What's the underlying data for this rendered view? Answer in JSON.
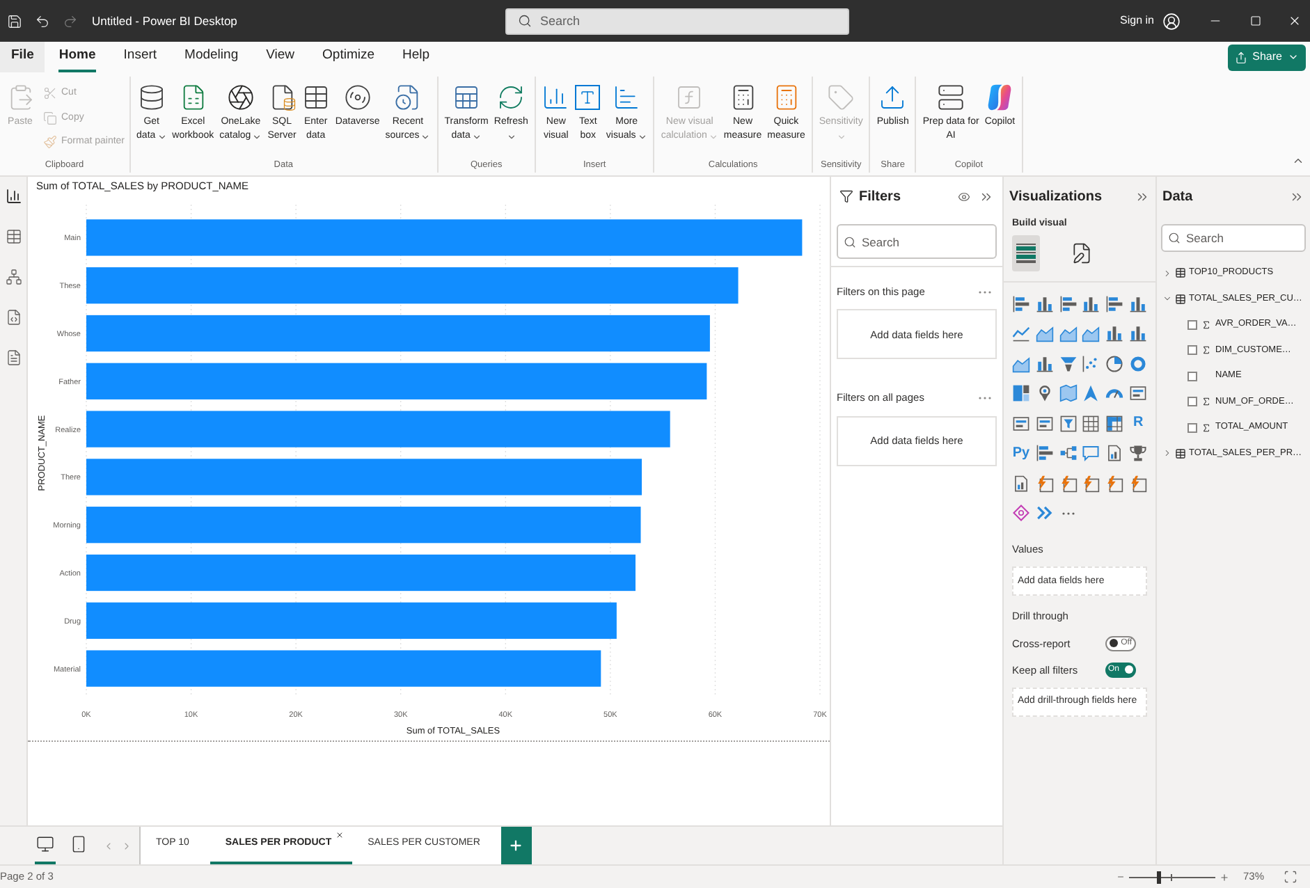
{
  "title_bar": {
    "quick_access": [
      {
        "kind": "save",
        "disabled": false
      },
      {
        "kind": "undo",
        "disabled": false
      },
      {
        "kind": "redo",
        "disabled": true
      }
    ],
    "title": "Untitled - Power BI Desktop",
    "search": {
      "placeholder": "Search"
    },
    "sign_in": "Sign in"
  },
  "menu_tabs": [
    {
      "label": "File",
      "kind": "menu",
      "selected": false
    },
    {
      "label": "Home",
      "kind": "tab",
      "selected": true
    },
    {
      "label": "Insert",
      "kind": "tab",
      "selected": false
    },
    {
      "label": "Modeling",
      "kind": "tab",
      "selected": false
    },
    {
      "label": "View",
      "kind": "tab",
      "selected": false
    },
    {
      "label": "Optimize",
      "kind": "tab",
      "selected": false
    },
    {
      "label": "Help",
      "kind": "tab",
      "selected": false
    }
  ],
  "share_button": {
    "label": "Share"
  },
  "ribbon": {
    "groups": [
      {
        "label": "Clipboard",
        "buttons": [
          {
            "lines": [
              "Paste"
            ],
            "kind": "large",
            "disabled": true,
            "dropdown": false
          },
          {
            "lines": [
              "Cut"
            ],
            "kind": "small",
            "disabled": true,
            "dropdown": false
          },
          {
            "lines": [
              "Copy"
            ],
            "kind": "small",
            "disabled": true,
            "dropdown": false
          },
          {
            "lines": [
              "Format painter"
            ],
            "kind": "small",
            "disabled": true,
            "dropdown": false
          }
        ]
      },
      {
        "label": "Data",
        "buttons": [
          {
            "lines": [
              "Get",
              "data"
            ],
            "kind": "large",
            "disabled": false,
            "dropdown": true
          },
          {
            "lines": [
              "Excel",
              "workbook"
            ],
            "kind": "large",
            "disabled": false,
            "dropdown": false
          },
          {
            "lines": [
              "OneLake",
              "catalog"
            ],
            "kind": "large",
            "disabled": false,
            "dropdown": true
          },
          {
            "lines": [
              "SQL",
              "Server"
            ],
            "kind": "large",
            "disabled": false,
            "dropdown": false
          },
          {
            "lines": [
              "Enter",
              "data"
            ],
            "kind": "large",
            "disabled": false,
            "dropdown": false
          },
          {
            "lines": [
              "Dataverse"
            ],
            "kind": "large",
            "disabled": false,
            "dropdown": false
          },
          {
            "lines": [
              "Recent",
              "sources"
            ],
            "kind": "large",
            "disabled": false,
            "dropdown": true
          }
        ]
      },
      {
        "label": "Queries",
        "buttons": [
          {
            "lines": [
              "Transform",
              "data"
            ],
            "kind": "large",
            "disabled": false,
            "dropdown": true
          },
          {
            "lines": [
              "Refresh"
            ],
            "kind": "large",
            "disabled": false,
            "dropdown": true
          }
        ]
      },
      {
        "label": "Insert",
        "buttons": [
          {
            "lines": [
              "New",
              "visual"
            ],
            "kind": "large",
            "disabled": false,
            "dropdown": false
          },
          {
            "lines": [
              "Text",
              "box"
            ],
            "kind": "large",
            "disabled": false,
            "dropdown": false
          },
          {
            "lines": [
              "More",
              "visuals"
            ],
            "kind": "large",
            "disabled": false,
            "dropdown": true
          }
        ]
      },
      {
        "label": "Calculations",
        "buttons": [
          {
            "lines": [
              "New visual",
              "calculation"
            ],
            "kind": "large",
            "disabled": true,
            "dropdown": true
          },
          {
            "lines": [
              "New",
              "measure"
            ],
            "kind": "large",
            "disabled": false,
            "dropdown": false
          },
          {
            "lines": [
              "Quick",
              "measure"
            ],
            "kind": "large",
            "disabled": false,
            "dropdown": false
          }
        ]
      },
      {
        "label": "Sensitivity",
        "buttons": [
          {
            "lines": [
              "Sensitivity"
            ],
            "kind": "large",
            "disabled": true,
            "dropdown": true
          }
        ]
      },
      {
        "label": "Share",
        "buttons": [
          {
            "lines": [
              "Publish"
            ],
            "kind": "large",
            "disabled": false,
            "dropdown": false
          }
        ]
      },
      {
        "label": "Copilot",
        "buttons": [
          {
            "lines": [
              "Prep data for",
              "AI"
            ],
            "kind": "large",
            "disabled": false,
            "dropdown": false
          },
          {
            "lines": [
              "Copilot"
            ],
            "kind": "large",
            "disabled": false,
            "dropdown": false
          }
        ]
      }
    ]
  },
  "report_page": {
    "visual": {
      "chart_data": {
        "type": "bar",
        "orientation": "horizontal",
        "grid": true,
        "title": "Sum of TOTAL_SALES by PRODUCT_NAME",
        "xlabel": "Sum of TOTAL_SALES",
        "ylabel": "PRODUCT_NAME",
        "categories": [
          "Main",
          "These",
          "Whose",
          "Father",
          "Realize",
          "There",
          "Morning",
          "Action",
          "Drug",
          "Material"
        ],
        "values": [
          68300,
          62200,
          59500,
          59200,
          55700,
          53000,
          52900,
          52400,
          50600,
          49100
        ],
        "xlim": [
          0,
          70000
        ],
        "xticks": [
          {
            "value": 0,
            "label": "0K"
          },
          {
            "value": 10000,
            "label": "10K"
          },
          {
            "value": 20000,
            "label": "20K"
          },
          {
            "value": 30000,
            "label": "30K"
          },
          {
            "value": 40000,
            "label": "40K"
          },
          {
            "value": 50000,
            "label": "50K"
          },
          {
            "value": 60000,
            "label": "60K"
          },
          {
            "value": 70000,
            "label": "70K"
          }
        ]
      }
    }
  },
  "layout_views": [
    {
      "kind": "desktop",
      "selected": true
    },
    {
      "kind": "mobile",
      "selected": false
    }
  ],
  "page_tabs": [
    {
      "label": "TOP 10",
      "selected": false
    },
    {
      "label": "SALES PER PRODUCT",
      "selected": true
    },
    {
      "label": "SALES PER CUSTOMER",
      "selected": false
    }
  ],
  "filters_pane": {
    "title": "Filters",
    "search": {
      "placeholder": "Search"
    },
    "sections": [
      {
        "label": "Filters on this page",
        "hint": "Add data fields here"
      },
      {
        "label": "Filters on all pages",
        "hint": "Add data fields here"
      }
    ]
  },
  "visualizations_pane": {
    "title": "Visualizations",
    "subtitle": "Build visual",
    "modes": [
      {
        "kind": "build",
        "selected": true
      },
      {
        "kind": "format",
        "selected": false
      }
    ],
    "gallery_letters": [
      "R",
      "Py"
    ],
    "sections": [
      {
        "kind": "label",
        "text": "Values"
      },
      {
        "kind": "drop",
        "text": "Add data fields here"
      },
      {
        "kind": "label",
        "text": "Drill through"
      },
      {
        "kind": "toggle",
        "text": "Cross-report",
        "on": false,
        "state_text": "Off"
      },
      {
        "kind": "toggle",
        "text": "Keep all filters",
        "on": true,
        "state_text": "On"
      },
      {
        "kind": "drop",
        "text": "Add drill-through fields here"
      }
    ]
  },
  "data_pane": {
    "title": "Data",
    "search": {
      "placeholder": "Search"
    },
    "tables": [
      {
        "name": "TOP10_PRODUCTS",
        "expanded": false
      },
      {
        "name": "TOTAL_SALES_PER_CU…",
        "expanded": true,
        "fields": [
          {
            "name": "AVR_ORDER_VA…",
            "kind": "numeric",
            "checked": false
          },
          {
            "name": "DIM_CUSTOME…",
            "kind": "numeric",
            "checked": false
          },
          {
            "name": "NAME",
            "kind": "text",
            "checked": false
          },
          {
            "name": "NUM_OF_ORDE…",
            "kind": "numeric",
            "checked": false
          },
          {
            "name": "TOTAL_AMOUNT",
            "kind": "numeric",
            "checked": false
          }
        ]
      },
      {
        "name": "TOTAL_SALES_PER_PR…",
        "expanded": false
      }
    ]
  },
  "status_bar": {
    "page_info": "Page 2 of 3",
    "zoom": {
      "level": 0.35,
      "reading": "73%"
    }
  }
}
